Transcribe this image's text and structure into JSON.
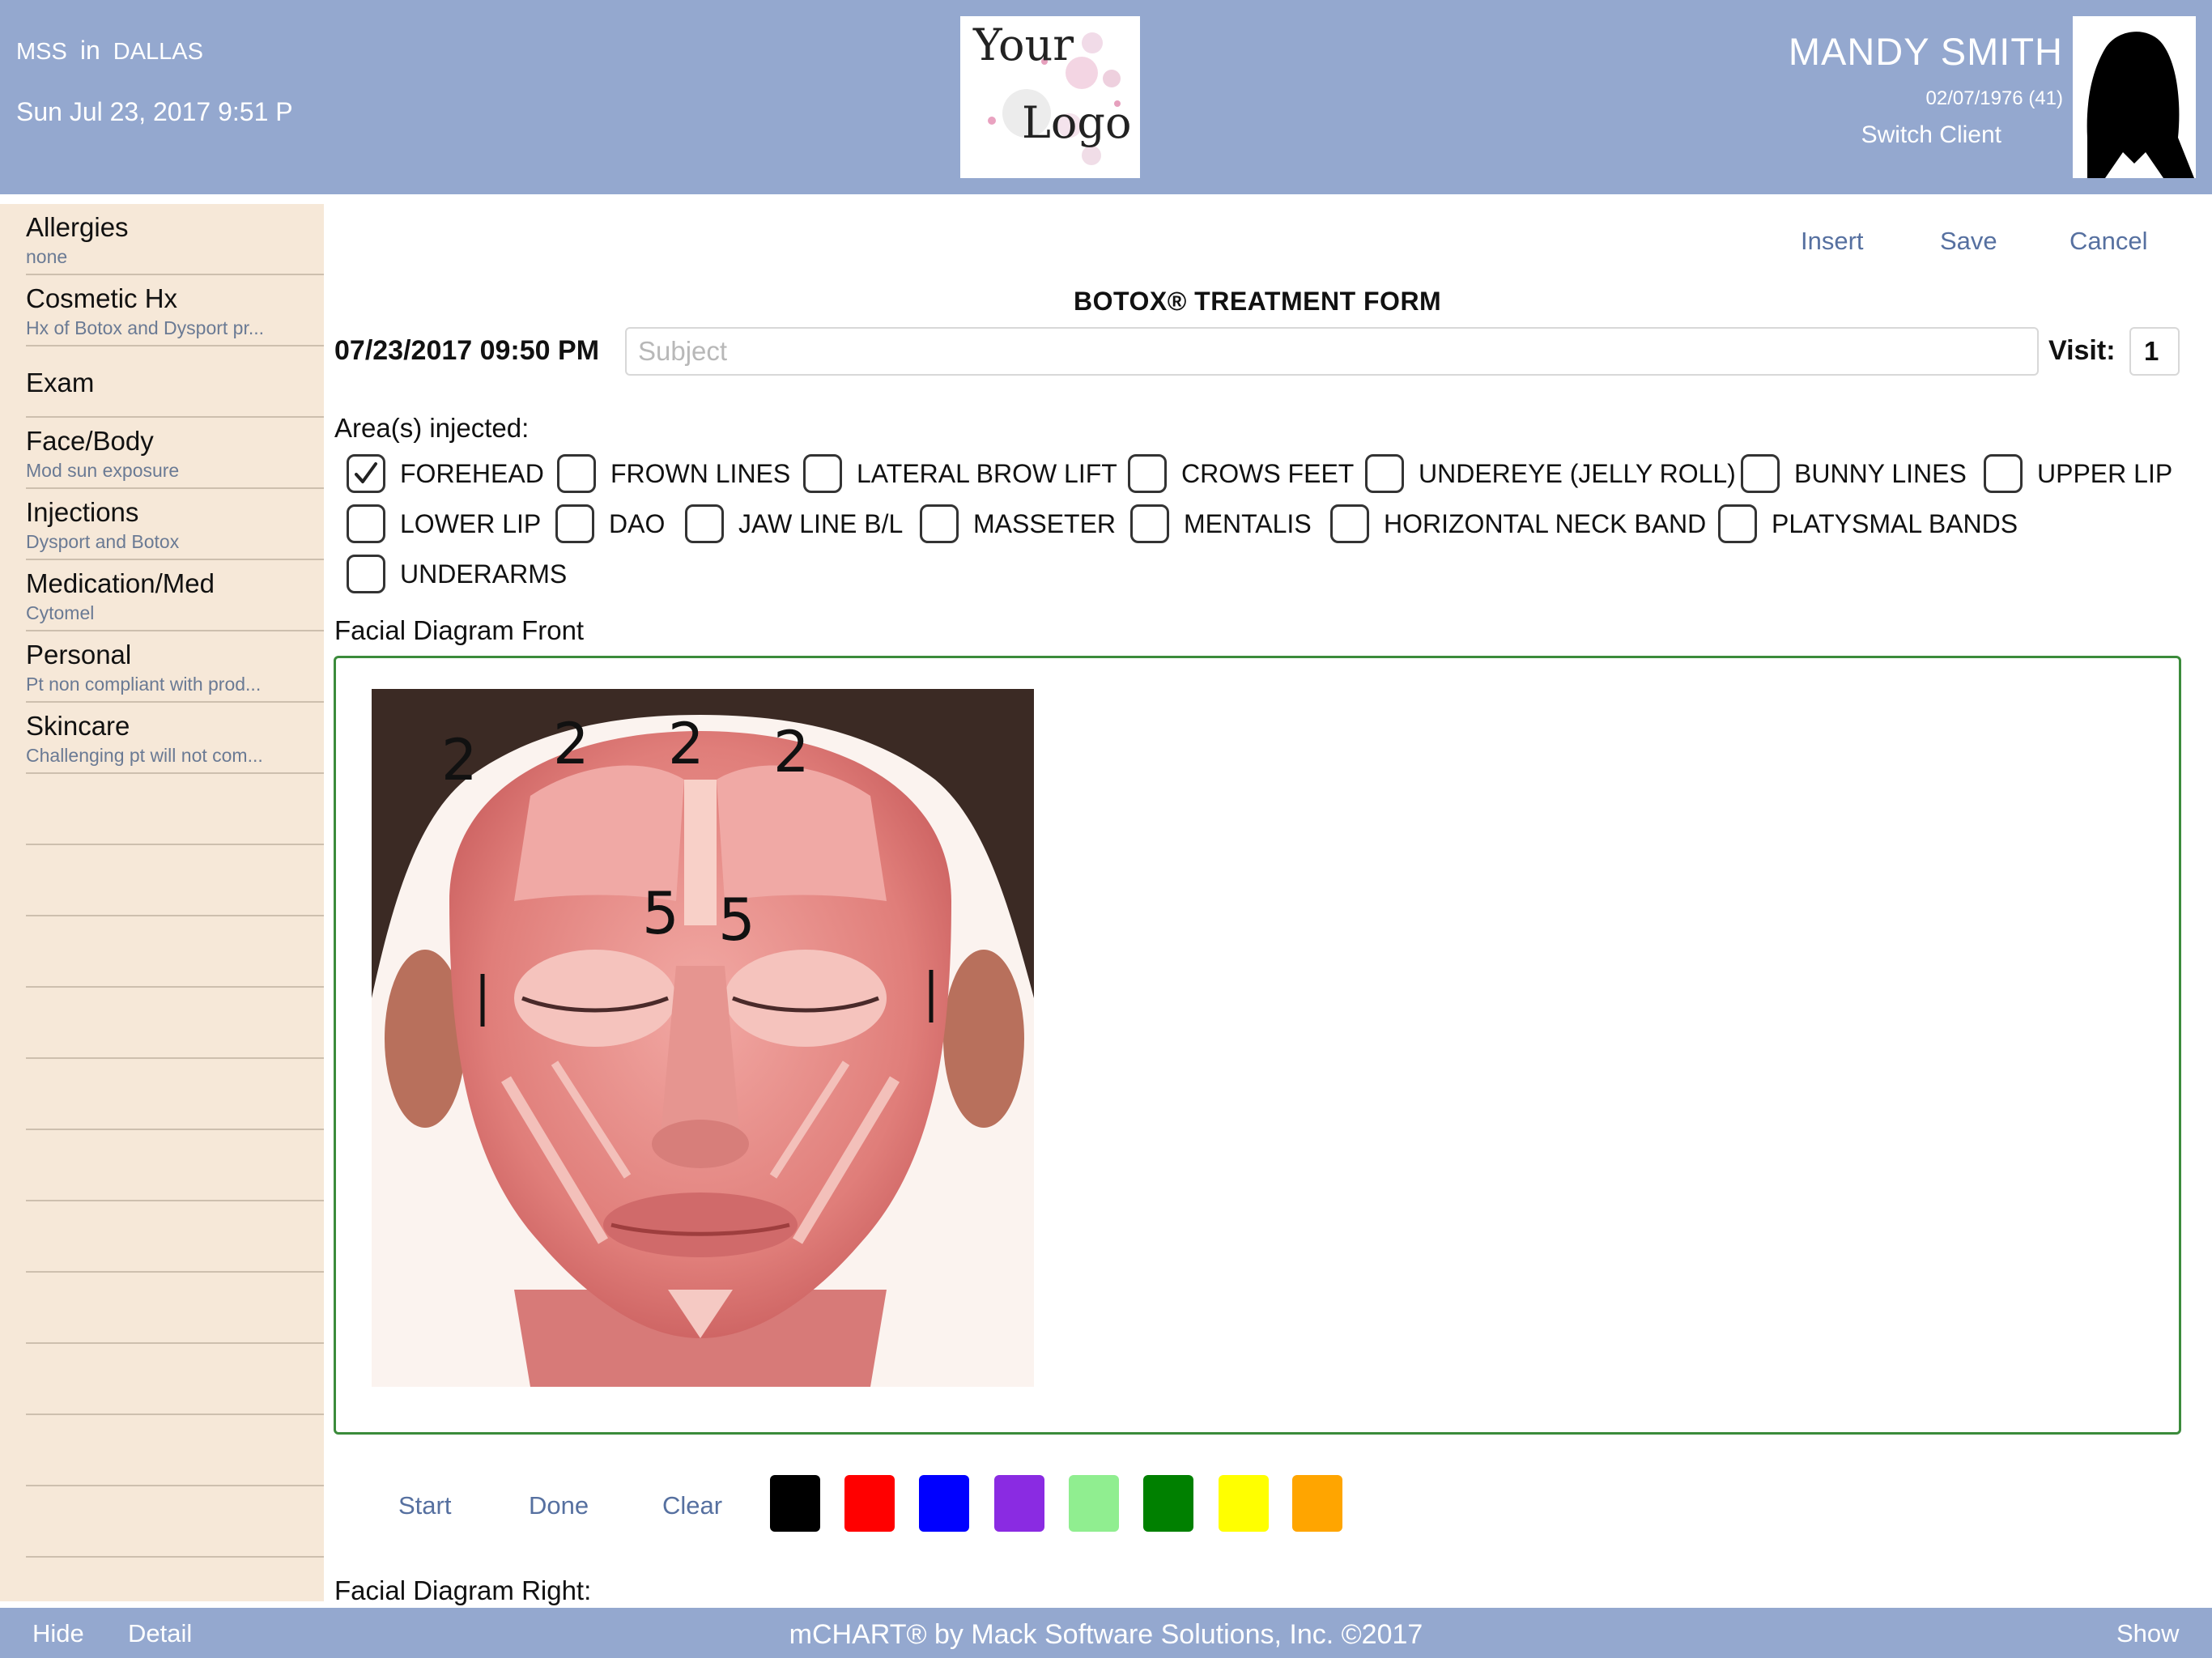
{
  "header": {
    "user_code": "MSS",
    "in_word": "in",
    "location": "DALLAS",
    "datetime": "Sun Jul 23, 2017  9:51 P",
    "logo_line1": "Your",
    "logo_line2": "Logo",
    "client_name": "MANDY SMITH",
    "client_dob": "02/07/1976 (41)",
    "switch_client": "Switch Client"
  },
  "sidebar": {
    "items": [
      {
        "title": "Allergies",
        "subtitle": "none"
      },
      {
        "title": "Cosmetic Hx",
        "subtitle": "Hx of Botox and Dysport  pr..."
      },
      {
        "title": "Exam",
        "subtitle": ""
      },
      {
        "title": "Face/Body",
        "subtitle": "Mod sun exposure"
      },
      {
        "title": "Injections",
        "subtitle": "Dysport and Botox"
      },
      {
        "title": "Medication/Med",
        "subtitle": "Cytomel"
      },
      {
        "title": "Personal",
        "subtitle": "Pt non compliant with prod..."
      },
      {
        "title": "Skincare",
        "subtitle": "Challenging pt will not com..."
      }
    ]
  },
  "actions": {
    "insert": "Insert",
    "save": "Save",
    "cancel": "Cancel"
  },
  "form": {
    "title": "BOTOX® TREATMENT FORM",
    "datetime": "07/23/2017 09:50 PM",
    "subject_placeholder": "Subject",
    "visit_label": "Visit:",
    "visit_value": "1",
    "areas_label": "Area(s) injected:",
    "areas": [
      {
        "label": "FOREHEAD",
        "checked": true
      },
      {
        "label": "FROWN LINES",
        "checked": false
      },
      {
        "label": "LATERAL BROW LIFT",
        "checked": false
      },
      {
        "label": "CROWS FEET",
        "checked": false
      },
      {
        "label": "UNDEREYE (JELLY ROLL)",
        "checked": false
      },
      {
        "label": "BUNNY LINES",
        "checked": false
      },
      {
        "label": "UPPER LIP",
        "checked": false
      },
      {
        "label": "LOWER LIP",
        "checked": false
      },
      {
        "label": "DAO",
        "checked": false
      },
      {
        "label": "JAW LINE B/L",
        "checked": false
      },
      {
        "label": "MASSETER",
        "checked": false
      },
      {
        "label": "MENTALIS",
        "checked": false
      },
      {
        "label": "HORIZONTAL NECK BAND",
        "checked": false
      },
      {
        "label": "PLATYSMAL BANDS",
        "checked": false
      },
      {
        "label": "UNDERARMS",
        "checked": false
      }
    ],
    "diagram_front_label": "Facial Diagram Front",
    "diagram_marks": [
      "2",
      "2",
      "2",
      "2",
      "5",
      "5"
    ],
    "diagram_right_label": "Facial Diagram Right:"
  },
  "drawing_tools": {
    "start": "Start",
    "done": "Done",
    "clear": "Clear",
    "colors": [
      "#000000",
      "#ff0000",
      "#0000ff",
      "#8a2be2",
      "#90ee90",
      "#008000",
      "#ffff00",
      "#ffa500"
    ]
  },
  "footer": {
    "hide": "Hide",
    "detail": "Detail",
    "copyright": "mCHART® by Mack Software Solutions, Inc. ©2017",
    "show": "Show"
  },
  "theme": {
    "header_bg": "#94a8cf",
    "sidebar_bg": "#f6e8d8",
    "link_color": "#5670a0",
    "canvas_border": "#3b8b3b"
  }
}
